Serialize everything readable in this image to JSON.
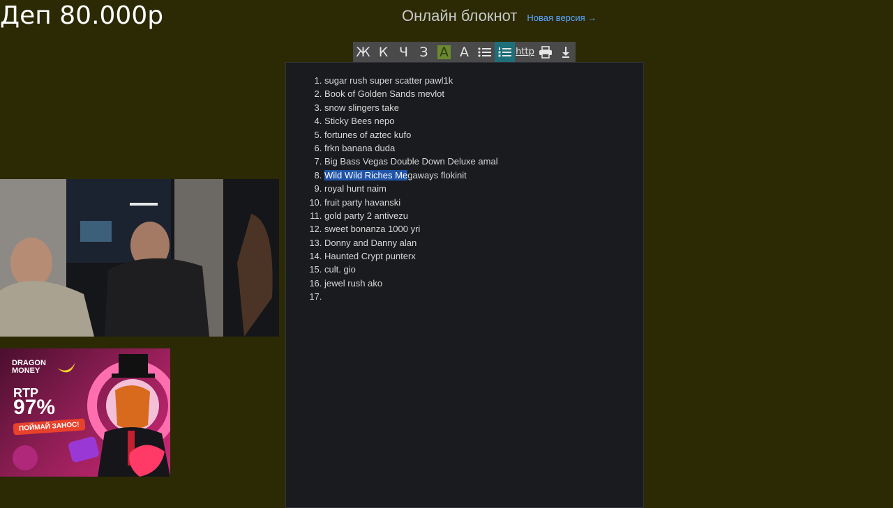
{
  "overlay": {
    "deposit_text": "Деп 80.000р"
  },
  "header": {
    "title": "Онлайн блокнот",
    "new_version_link": "Новая версия →"
  },
  "toolbar": {
    "buttons": [
      {
        "label": "Ж",
        "icon": "bold-icon"
      },
      {
        "label": "К",
        "icon": "italic-icon"
      },
      {
        "label": "Ч",
        "icon": "underline-icon"
      },
      {
        "label": "З",
        "icon": "strikethrough-icon"
      },
      {
        "label": "A",
        "icon": "highlight-icon"
      },
      {
        "label": "A",
        "icon": "text-color-icon"
      },
      {
        "label": "",
        "icon": "bulleted-list-icon"
      },
      {
        "label": "",
        "icon": "numbered-list-icon"
      },
      {
        "label": "http",
        "icon": "link-icon"
      },
      {
        "label": "",
        "icon": "print-icon"
      },
      {
        "label": "",
        "icon": "download-icon"
      }
    ],
    "active_button": "numbered-list-icon"
  },
  "editor": {
    "items": [
      "sugar rush super scatter pawl1k",
      "Book of Golden Sands mevlot",
      "snow slingers take",
      "Sticky Bees nepo",
      "fortunes of aztec kufo",
      "frkn banana duda",
      "Big Bass Vegas Double Down Deluxe amal",
      "",
      "royal hunt naim",
      "fruit party havanski",
      "gold party 2 antivezu",
      "sweet bonanza 1000 yri",
      "Donny and Danny alan",
      "Haunted Crypt punterx",
      "cult. gio",
      "jewel rush ako",
      ""
    ],
    "selected_item": {
      "selected_part": "Wild Wild Riches Me",
      "rest": "gaways flokinit"
    }
  },
  "ad": {
    "brand": "DRAGON MONEY",
    "rtp_label": "RTP",
    "rtp_value": "97%",
    "cta": "ПОЙМАЙ ЗАНОС!"
  },
  "colors": {
    "background": "#2b2a04",
    "editor_bg": "#1a1b1e",
    "active_tool": "#1e6f7a",
    "selection": "#1f54a8",
    "link": "#5aa7ff"
  }
}
